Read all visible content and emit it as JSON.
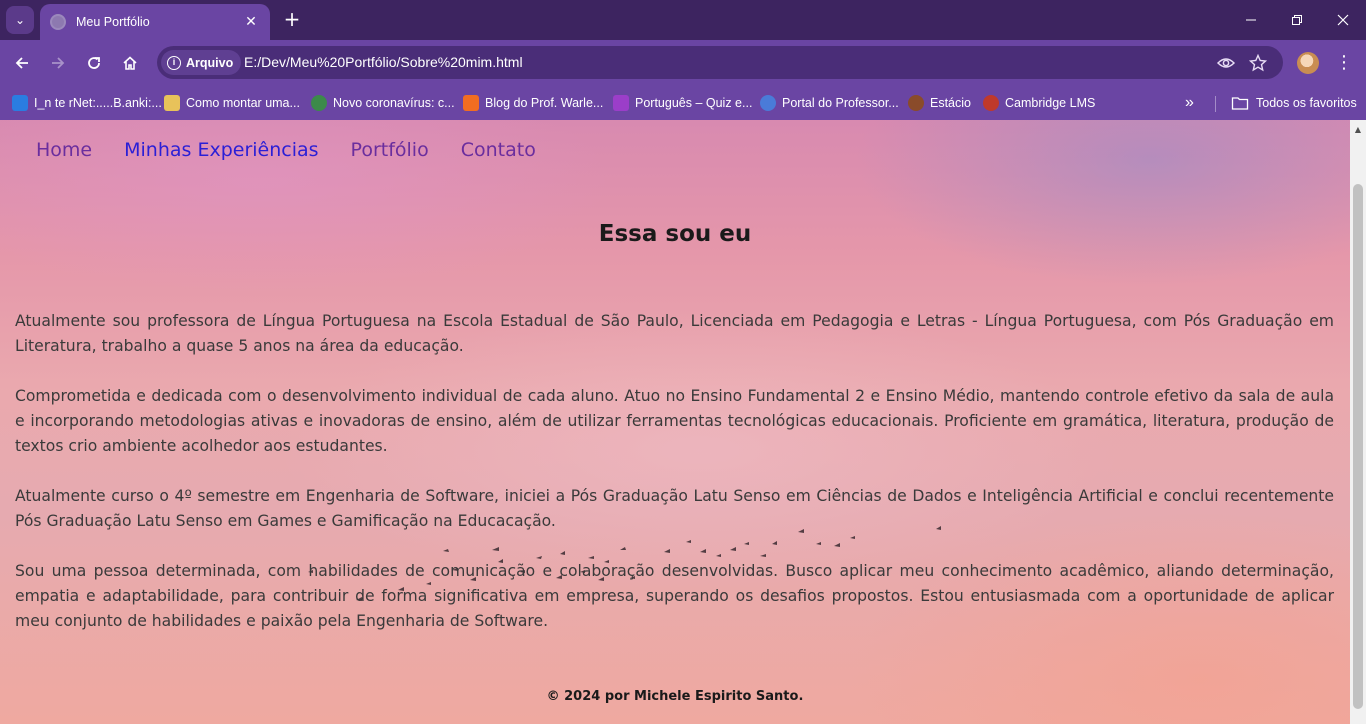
{
  "browser": {
    "tab_title": "Meu Portfólio",
    "new_tab_symbol": "+",
    "close_symbol": "✕",
    "url_chip_label": "Arquivo",
    "url": "E:/Dev/Meu%20Portfólio/Sobre%20mim.html",
    "bookmarks": [
      {
        "label": "I_n te rNet:.....B.anki:...",
        "icon_color": "#2a7de1"
      },
      {
        "label": "Como montar uma...",
        "icon_color": "#e8c25a"
      },
      {
        "label": "Novo coronavírus: c...",
        "icon_color": "#3c8a4a"
      },
      {
        "label": "Blog do Prof. Warle...",
        "icon_color": "#f26d21"
      },
      {
        "label": "Português – Quiz e...",
        "icon_color": "#9b3ec9"
      },
      {
        "label": "Portal do Professor...",
        "icon_color": "#4a7bd8"
      },
      {
        "label": "Estácio",
        "icon_color": "#8a4b2a"
      },
      {
        "label": "Cambridge LMS",
        "icon_color": "#c0392b"
      }
    ],
    "more_bookmarks_symbol": "»",
    "all_bookmarks_label": "Todos os favoritos"
  },
  "site": {
    "nav": [
      {
        "label": "Home"
      },
      {
        "label": "Minhas Experiências"
      },
      {
        "label": "Portfólio"
      },
      {
        "label": "Contato"
      }
    ],
    "heading": "Essa sou eu",
    "paragraphs": [
      "Atualmente sou professora de Língua Portuguesa na Escola Estadual de São Paulo, Licenciada em Pedagogia e Letras - Língua Portuguesa, com Pós Graduação em Literatura, trabalho a quase 5 anos na área da educação.",
      "Comprometida e dedicada com o desenvolvimento individual de cada aluno. Atuo no Ensino Fundamental 2 e Ensino Médio, mantendo controle efetivo da sala de aula e incorporando metodologias ativas e inovadoras de ensino, além de utilizar ferramentas tecnológicas educacionais. Proficiente em gramática, literatura, produção de textos crio ambiente acolhedor aos estudantes.",
      "Atualmente curso o 4º semestre em Engenharia de Software, iniciei a Pós Graduação Latu Senso em Ciências de Dados e Inteligência Artificial e conclui recentemente Pós Graduação Latu Senso em Games e Gamificação na Educacação.",
      "Sou uma pessoa determinada, com habilidades de comunicação e colaboração desenvolvidas. Busco aplicar meu conhecimento acadêmico, aliando determinação, empatia e adaptabilidade, para contribuir de forma significativa em empresa, superando os desafios propostos. Estou entusiasmada com a oportunidade de aplicar meu conjunto de habilidades e paixão pela Engenharia de Software."
    ],
    "footer": "© 2024 por Michele Espirito Santo."
  }
}
